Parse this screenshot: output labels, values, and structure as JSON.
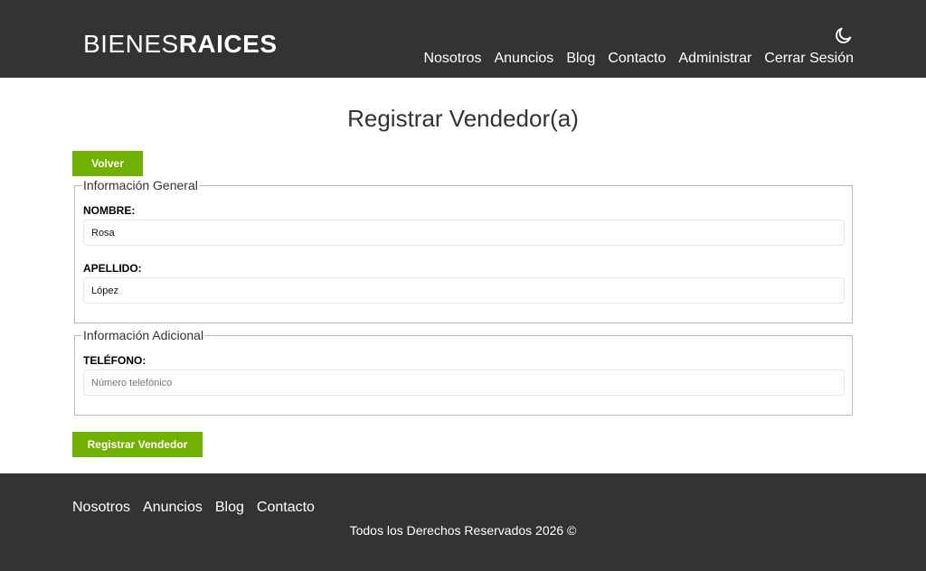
{
  "header": {
    "logo_light": "BIENES",
    "logo_bold": "RAICES",
    "theme_icon": "moon-icon",
    "nav": [
      "Nosotros",
      "Anuncios",
      "Blog",
      "Contacto",
      "Administrar",
      "Cerrar Sesión"
    ]
  },
  "main": {
    "title": "Registrar Vendedor(a)",
    "back_button": "Volver",
    "general": {
      "legend": "Información General",
      "nombre_label": "NOMBRE:",
      "nombre_value": "Rosa",
      "apellido_label": "APELLIDO:",
      "apellido_value": "López"
    },
    "adicional": {
      "legend": "Información Adicional",
      "telefono_label": "TELÉFONO:",
      "telefono_placeholder": "Número telefónico",
      "telefono_value": ""
    },
    "submit_button": "Registrar Vendedor"
  },
  "footer": {
    "nav": [
      "Nosotros",
      "Anuncios",
      "Blog",
      "Contacto"
    ],
    "copyright": "Todos los Derechos Reservados 2026 ©"
  },
  "colors": {
    "header_bg": "#333333",
    "accent": "#71b100"
  }
}
